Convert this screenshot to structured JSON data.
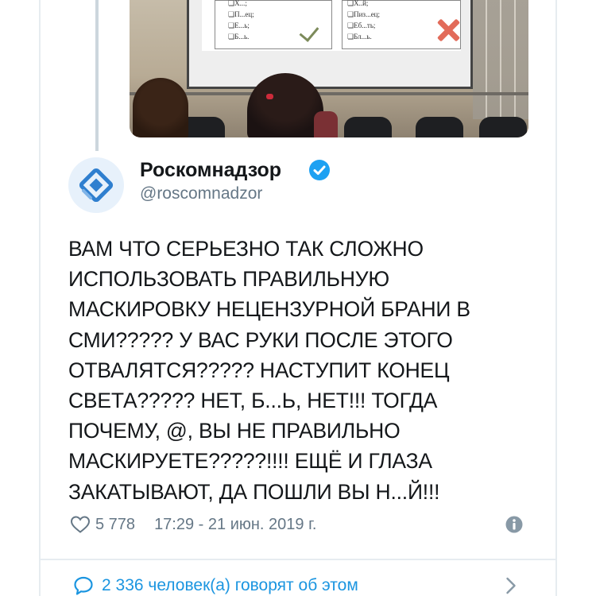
{
  "quoted_image": {
    "left_options": [
      "❏X...;",
      "❏П...ец;",
      "❏Е...ь;",
      "❏Б...ь."
    ],
    "right_options": [
      "❏X..й;",
      "❏Пиз...ец;",
      "❏Еб...ть;",
      "❏Бл...ь."
    ]
  },
  "tweet": {
    "author_name": "Роскомнадзор",
    "author_handle": "@roscomnadzor",
    "verified": true,
    "text": "ВАМ ЧТО СЕРЬЕЗНО ТАК СЛОЖНО\nИСПОЛЬЗОВАТЬ ПРАВИЛЬНУЮ\nМАСКИРОВКУ НЕЦЕНЗУРНОЙ БРАНИ В\nСМИ????? У ВАС РУКИ ПОСЛЕ ЭТОГО\nОТВАЛЯТСЯ????? НАСТУПИТ КОНЕЦ\nСВЕТА????? НЕТ, Б...Ь, НЕТ!!! ТОГДА\nПОЧЕМУ, @, ВЫ НЕ ПРАВИЛЬНО\nМАСКИРУЕТЕ?????!!!! ЕЩЁ И ГЛАЗА\nЗАКАТЫВАЮТ, ДА ПОШЛИ ВЫ Н...Й!!!",
    "likes": "5 778",
    "timestamp": "17:29 - 21 июн. 2019 г.",
    "replies_text": "2 336 человек(а) говорят об этом"
  },
  "colors": {
    "accent": "#1b95e0",
    "secondary_text": "#657786",
    "border": "#e6ecf0"
  },
  "icons": [
    "heart-icon",
    "info-icon",
    "speech-bubble-icon",
    "chevron-right-icon",
    "verified-badge-icon"
  ]
}
